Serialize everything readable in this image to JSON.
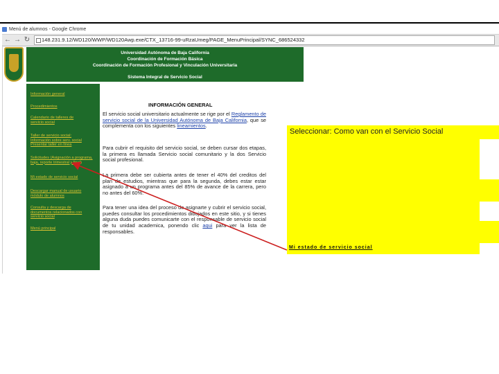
{
  "browser": {
    "tab_title": "Menú de alumnos - Google Chrome",
    "address_url": "148.231.9.12/WD120/WWP/WD120Awp.exe/CTX_13716-99-uRzaUmeg/PAGE_MenuPrincipal/SYNC_686524332"
  },
  "header": {
    "line1": "Universidad Autónoma de Baja California",
    "line2": "Coordinación de Formación Básica",
    "line3": "Coordinación de Formación Profesional y Vinculación Universitaria",
    "system": "Sistema Integral de Servicio Social"
  },
  "sidebar": {
    "items": [
      {
        "label": "Información general"
      },
      {
        "label": "Procedimientos"
      },
      {
        "label": "Calendario de talleres de servicio social"
      },
      {
        "label": "Taller de servicio social: Información sobre serv. social Presentar taller en línea"
      },
      {
        "label": "Solicitudes (Asignación a programa, baja, reporte trimestral y final)"
      },
      {
        "label": "Mi estado de servicio social"
      },
      {
        "label": "Descargar manual de usuario módulo de alumnos"
      },
      {
        "label": "Consulta y descarga de documentos relacionados con servicio social"
      },
      {
        "label": "Menú principal"
      }
    ]
  },
  "content": {
    "heading": "INFORMACIÓN GENERAL",
    "p1_a": "El servicio social universitario actualmente se rige por el ",
    "p1_link": "Reglamento de servicio social de la Universidad Autónoma de Baja California",
    "p1_b": ", que se complementa con los siguientes ",
    "p1_link2": "lineamientos",
    "p1_c": ".",
    "p2": "Para cubrir el requisito del servicio social, se deben cursar dos etapas, la primera es llamada Servicio social comunitario y la dos Servicio social profesional.",
    "p3": "La primera debe ser cubierta antes de tener el 40% del creditos del plan de estudios, mientras que para la segunda, debes estar estar asignado a un programa antes del 85% de avance de la carrera, pero no antes del 60%.",
    "p4_a": "Para tener una idea del proceso de asignarte y cubrir el servicio social, puedes consultar los procedimientos dibujados en este sitio, y si tienes alguna duda puedes comunicarte con el responsable de servicio social de tu unidad academica, ponendo clic ",
    "p4_link": "aqui",
    "p4_b": " para ver la lista de responsables."
  },
  "callout": {
    "instruction": "Seleccionar:  Como van con el Servicio Social",
    "status_link": "Mi estado de servicio social"
  },
  "colors": {
    "brand_green": "#1e6b2a",
    "link_yellow": "#d9c230",
    "highlight": "#ffff00",
    "arrow": "#cc1f1f"
  }
}
